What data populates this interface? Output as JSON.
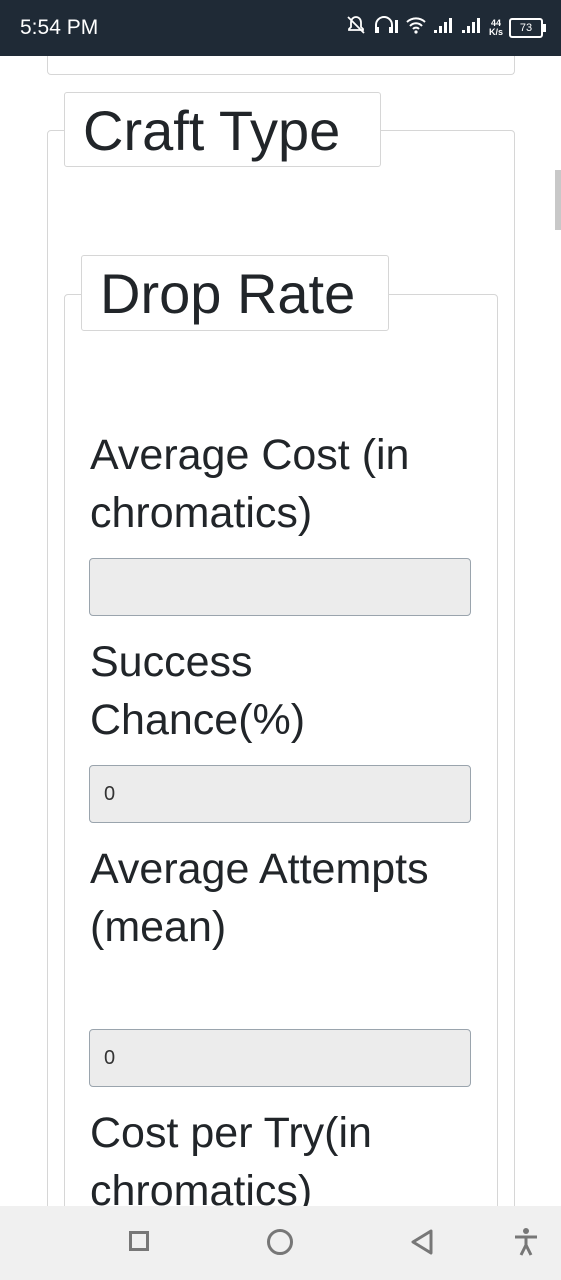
{
  "status_bar": {
    "time": "5:54 PM",
    "net_speed_value": "44",
    "net_speed_unit": "K/s",
    "battery": "73",
    "icons": [
      "bell-off-icon",
      "headset-icon",
      "wifi-icon",
      "signal-icon",
      "signal-icon",
      "battery-icon"
    ]
  },
  "form": {
    "outer_legend": "Craft Type",
    "inner_legend": "Drop Rate",
    "fields": [
      {
        "label": "Average Cost (in chromatics)",
        "value": ""
      },
      {
        "label": "Success Chance(%)",
        "value": "0"
      },
      {
        "label": "Average Attempts (mean)",
        "value": "0"
      },
      {
        "label": "Cost per Try(in chromatics)",
        "value": ""
      }
    ]
  },
  "nav_bar": {
    "buttons": [
      "recents-icon",
      "home-icon",
      "back-icon",
      "accessibility-icon"
    ]
  }
}
